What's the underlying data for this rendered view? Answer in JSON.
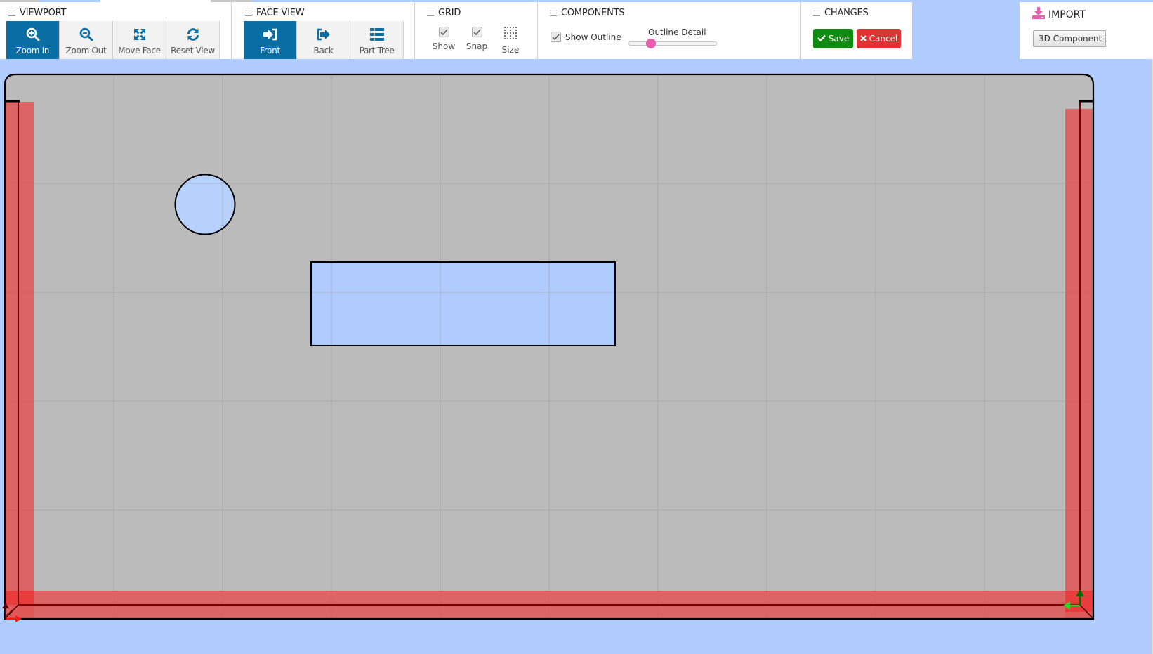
{
  "toolbar": {
    "viewport": {
      "title": "VIEWPORT",
      "buttons": [
        {
          "label": "Zoom In",
          "icon": "zoom-in-icon",
          "active": true
        },
        {
          "label": "Zoom Out",
          "icon": "zoom-out-icon",
          "active": false
        },
        {
          "label": "Move Face",
          "icon": "move-face-icon",
          "active": false
        },
        {
          "label": "Reset View",
          "icon": "reset-view-icon",
          "active": false
        }
      ]
    },
    "face_view": {
      "title": "FACE VIEW",
      "buttons": [
        {
          "label": "Front",
          "icon": "sign-in-icon",
          "active": true
        },
        {
          "label": "Back",
          "icon": "sign-out-icon",
          "active": false
        },
        {
          "label": "Part Tree",
          "icon": "list-icon",
          "active": false
        }
      ]
    },
    "grid": {
      "title": "GRID",
      "show": {
        "label": "Show",
        "checked": true
      },
      "snap": {
        "label": "Snap",
        "checked": true
      },
      "size": {
        "label": "Size",
        "icon": "grid-size-icon"
      }
    },
    "components": {
      "title": "COMPONENTS",
      "show_outline": {
        "label": "Show Outline",
        "checked": true
      },
      "outline_detail": {
        "label": "Outline Detail",
        "value_percent": 25
      }
    },
    "changes": {
      "title": "CHANGES",
      "save_label": "Save",
      "cancel_label": "Cancel"
    },
    "import": {
      "title": "IMPORT",
      "button_label": "3D Component"
    }
  },
  "colors": {
    "accent": "#0b6ea3",
    "save": "#108a10",
    "cancel": "#e03434",
    "slider_thumb": "#e75fae",
    "import_icon": "#e75fae",
    "canvas_bg": "#bbbbbb",
    "shape_fill": "#b0cbfd",
    "edge_highlight": "#e05a5a",
    "page_bg": "#b0cbfd"
  },
  "viewport": {
    "shapes": [
      {
        "type": "circle",
        "name": "circle-cutout"
      },
      {
        "type": "rectangle",
        "name": "rectangle-cutout"
      }
    ],
    "axes": [
      "x-axis",
      "y-axis"
    ]
  }
}
